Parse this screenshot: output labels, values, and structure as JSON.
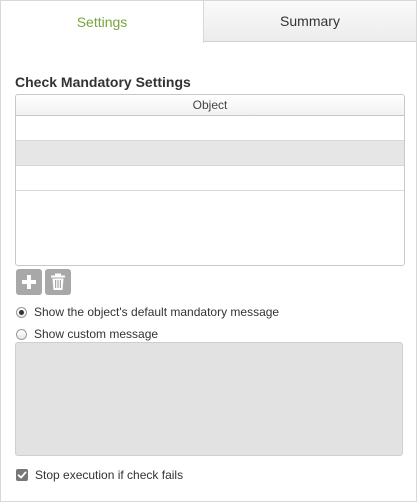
{
  "tabs": [
    {
      "label": "Settings",
      "active": true
    },
    {
      "label": "Summary",
      "active": false
    }
  ],
  "section_title": "Check Mandatory Settings",
  "grid": {
    "header": "Object",
    "rows": [
      "",
      "",
      ""
    ]
  },
  "toolbar": {
    "add_icon": "plus-icon",
    "delete_icon": "trash-icon"
  },
  "options": {
    "default_message_label": "Show the object's default mandatory message",
    "default_message_selected": true,
    "custom_message_label": "Show custom message",
    "custom_message_selected": false,
    "custom_message_value": ""
  },
  "stop_execution": {
    "label": "Stop execution if check fails",
    "checked": true
  },
  "colors": {
    "active_tab_text": "#7aa53a",
    "button_bg": "#a8a8a8"
  }
}
